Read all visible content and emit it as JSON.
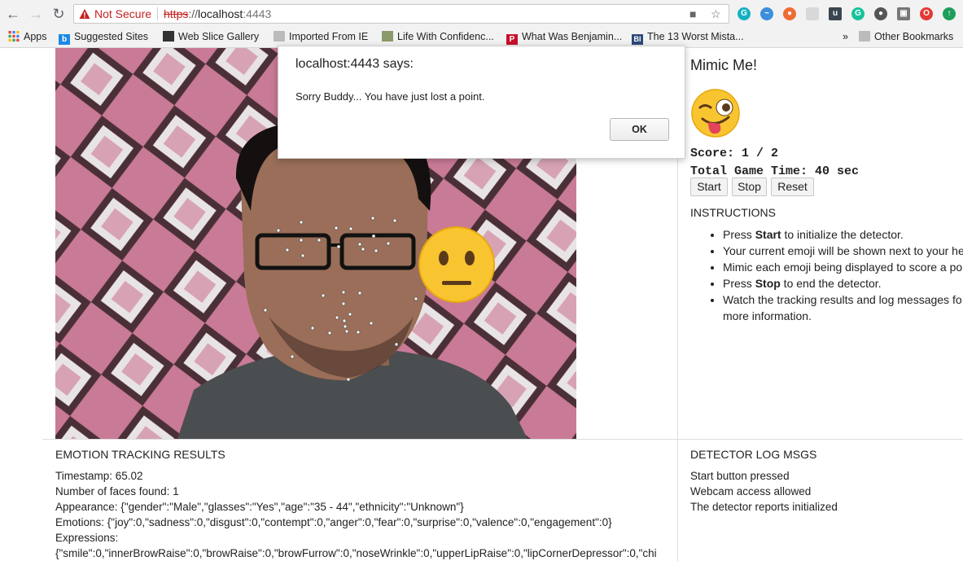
{
  "browser": {
    "security_label": "Not Secure",
    "url_scheme": "https",
    "url_rest": "://",
    "url_host": "localhost",
    "url_port": ":4443"
  },
  "bookmarks": [
    "Apps",
    "Suggested Sites",
    "Web Slice Gallery",
    "Imported From IE",
    "Life With Confidenc...",
    "What Was Benjamin...",
    "The 13 Worst Mista...",
    "Other Bookmarks"
  ],
  "bookmarks_overflow": "»",
  "game": {
    "title": "Mimic Me!",
    "score": "Score: 1 / 2",
    "time": "Total Game Time: 40 sec",
    "buttons": {
      "start": "Start",
      "stop": "Stop",
      "reset": "Reset"
    }
  },
  "instructions": {
    "heading": "INSTRUCTIONS",
    "items": [
      {
        "pre": "Press ",
        "bold": "Start",
        "post": " to initialize the detector."
      },
      {
        "pre": "Your current emoji will be shown next to your he",
        "bold": "",
        "post": ""
      },
      {
        "pre": "Mimic each emoji being displayed to score a po",
        "bold": "",
        "post": ""
      },
      {
        "pre": "Press ",
        "bold": "Stop",
        "post": " to end the detector."
      },
      {
        "pre": "Watch the tracking results and log messages fo",
        "bold": "",
        "post": ""
      }
    ],
    "item5_continued": "more information."
  },
  "results": {
    "heading": "EMOTION TRACKING RESULTS",
    "lines": [
      "Timestamp: 65.02",
      "Number of faces found: 1",
      "Appearance: {\"gender\":\"Male\",\"glasses\":\"Yes\",\"age\":\"35 - 44\",\"ethnicity\":\"Unknown\"}",
      "Emotions: {\"joy\":0,\"sadness\":0,\"disgust\":0,\"contempt\":0,\"anger\":0,\"fear\":0,\"surprise\":0,\"valence\":0,\"engagement\":0}",
      "Expressions:",
      "{\"smile\":0,\"innerBrowRaise\":0,\"browRaise\":0,\"browFurrow\":0,\"noseWrinkle\":0,\"upperLipRaise\":0,\"lipCornerDepressor\":0,\"chi"
    ]
  },
  "log": {
    "heading": "DETECTOR LOG MSGS",
    "lines": [
      "Start button pressed",
      "Webcam access allowed",
      "The detector reports initialized"
    ]
  },
  "dialog": {
    "title": "localhost:4443 says:",
    "message": "Sorry Buddy... You have just lost a point.",
    "ok": "OK"
  },
  "icons": {
    "target_emoji": "winking-face-with-tongue",
    "detected_emoji": "neutral-face"
  }
}
